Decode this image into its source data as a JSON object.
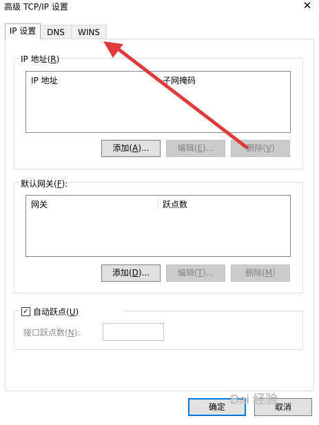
{
  "window": {
    "title": "高级 TCP/IP 设置",
    "close_glyph": "✕"
  },
  "tabs": [
    {
      "label": "IP 设置"
    },
    {
      "label": "DNS"
    },
    {
      "label": "WINS"
    }
  ],
  "ip_group": {
    "label_prefix": "IP 地址(",
    "label_key": "R",
    "label_suffix": ")",
    "columns": [
      "IP 地址",
      "子网掩码"
    ],
    "add": {
      "prefix": "添加(",
      "key": "A",
      "suffix": ")..."
    },
    "edit": {
      "prefix": "编辑(",
      "key": "E",
      "suffix": ")..."
    },
    "remove": {
      "prefix": "删除(",
      "key": "V",
      "suffix": ")"
    }
  },
  "gateway_group": {
    "label_prefix": "默认网关(",
    "label_key": "F",
    "label_suffix": "):",
    "columns": [
      "网关",
      "跃点数"
    ],
    "add": {
      "prefix": "添加(",
      "key": "D",
      "suffix": ")..."
    },
    "edit": {
      "prefix": "编辑(",
      "key": "T",
      "suffix": ")..."
    },
    "remove": {
      "prefix": "删除(",
      "key": "M",
      "suffix": ")"
    }
  },
  "metric": {
    "checkbox_checked": true,
    "check_glyph": "✓",
    "auto_prefix": "自动跃点(",
    "auto_key": "U",
    "auto_suffix": ")",
    "iface_prefix": "接口跃点数(",
    "iface_key": "N",
    "iface_suffix": "):",
    "iface_value": ""
  },
  "footer": {
    "ok_label": "确定",
    "cancel_label": "取消"
  },
  "watermark": {
    "text": "Bai 经验"
  },
  "colors": {
    "arrow": "#e03a3a",
    "primary_border": "#0078d7"
  }
}
